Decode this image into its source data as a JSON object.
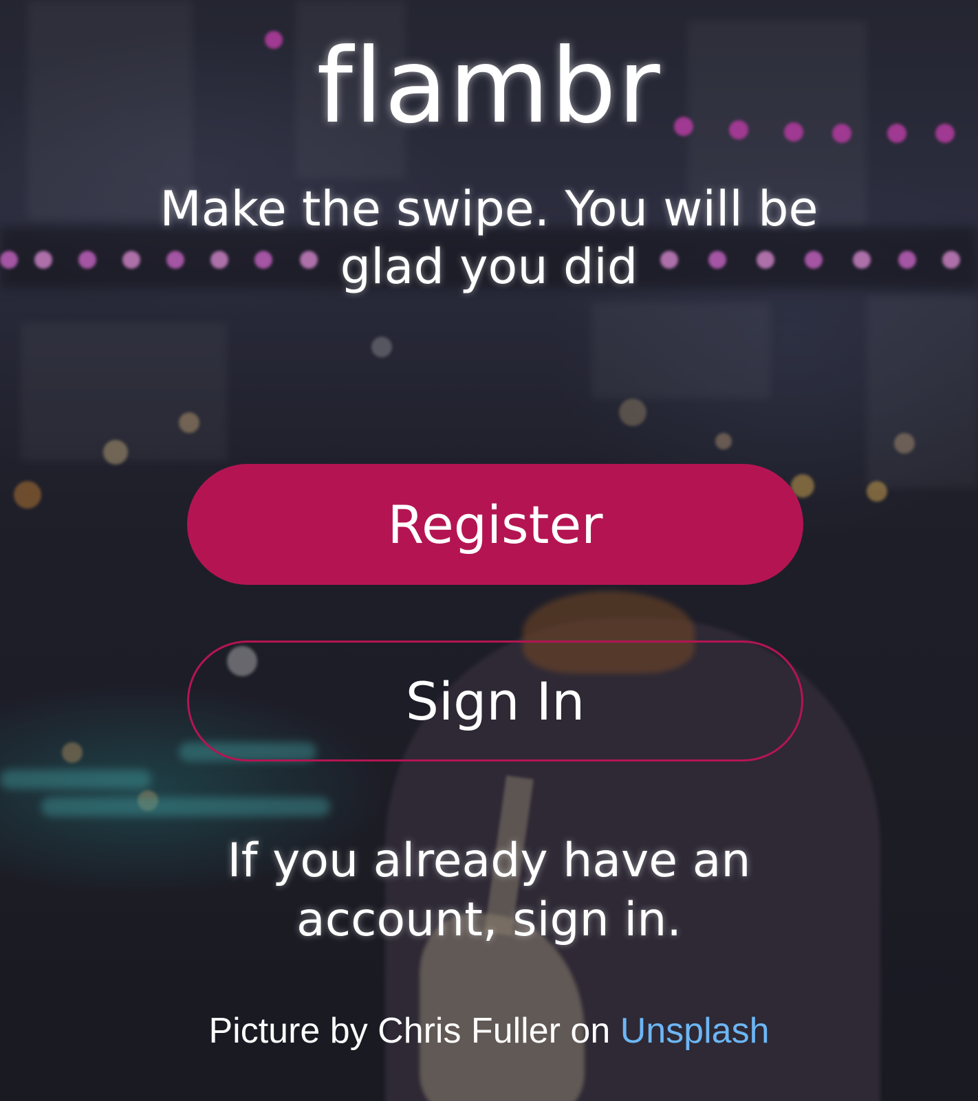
{
  "app": {
    "logo_text": "flambr",
    "tagline": "Make the swipe. You will be glad you did"
  },
  "actions": {
    "register_label": "Register",
    "signin_label": "Sign In"
  },
  "hint_text": "If you already have an account, sign in.",
  "credit": {
    "prefix": "Picture by Chris Fuller on",
    "link_text": "Unsplash"
  },
  "colors": {
    "accent": "#b41552",
    "link": "#6db6f5",
    "text": "#ffffff"
  }
}
